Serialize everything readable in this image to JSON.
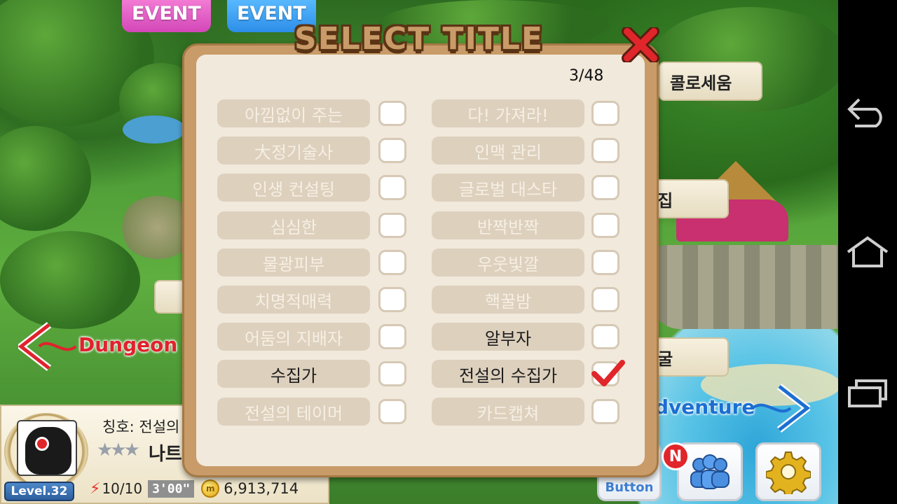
{
  "events": [
    "EVENT",
    "EVENT"
  ],
  "map": {
    "sign_top_right": "콜로세움",
    "sign_mid_right": "술집",
    "sign_low_right": "동굴",
    "nav_left": "Dungeon",
    "nav_right": "dventure"
  },
  "dialog": {
    "title": "SELECT TITLE",
    "counter": "3/48",
    "left_titles": [
      {
        "label": "아낌없이 주는",
        "owned": false,
        "checked": false
      },
      {
        "label": "大정기술사",
        "owned": false,
        "checked": false
      },
      {
        "label": "인생 컨설팅",
        "owned": false,
        "checked": false
      },
      {
        "label": "심심한",
        "owned": false,
        "checked": false
      },
      {
        "label": "물광피부",
        "owned": false,
        "checked": false
      },
      {
        "label": "치명적매력",
        "owned": false,
        "checked": false
      },
      {
        "label": "어둠의 지배자",
        "owned": false,
        "checked": false
      },
      {
        "label": "수집가",
        "owned": true,
        "checked": false
      },
      {
        "label": "전설의 테이머",
        "owned": false,
        "checked": false
      }
    ],
    "right_titles": [
      {
        "label": "다! 가져라!",
        "owned": false,
        "checked": false
      },
      {
        "label": "인맥 관리",
        "owned": false,
        "checked": false
      },
      {
        "label": "글로벌 대스타",
        "owned": false,
        "checked": false
      },
      {
        "label": "반짝반짝",
        "owned": false,
        "checked": false
      },
      {
        "label": "우웃빛깔",
        "owned": false,
        "checked": false
      },
      {
        "label": "핵꿀밤",
        "owned": false,
        "checked": false
      },
      {
        "label": "알부자",
        "owned": true,
        "checked": false
      },
      {
        "label": "전설의 수집가",
        "owned": true,
        "checked": true
      },
      {
        "label": "카드캡쳐",
        "owned": false,
        "checked": false
      }
    ]
  },
  "player": {
    "title_line": "칭호: 전설의",
    "stars": "★★★",
    "name": "나트",
    "level": "Level.32",
    "energy": "10/10",
    "timer": "3'00\"",
    "gold": "6,913,714"
  },
  "buttons": {
    "partial_label": "Button",
    "new_badge": "N"
  },
  "colors": {
    "owned_text": "#1e1e1e",
    "unowned_text": "#f6efe4",
    "check_red": "#e0262a"
  }
}
